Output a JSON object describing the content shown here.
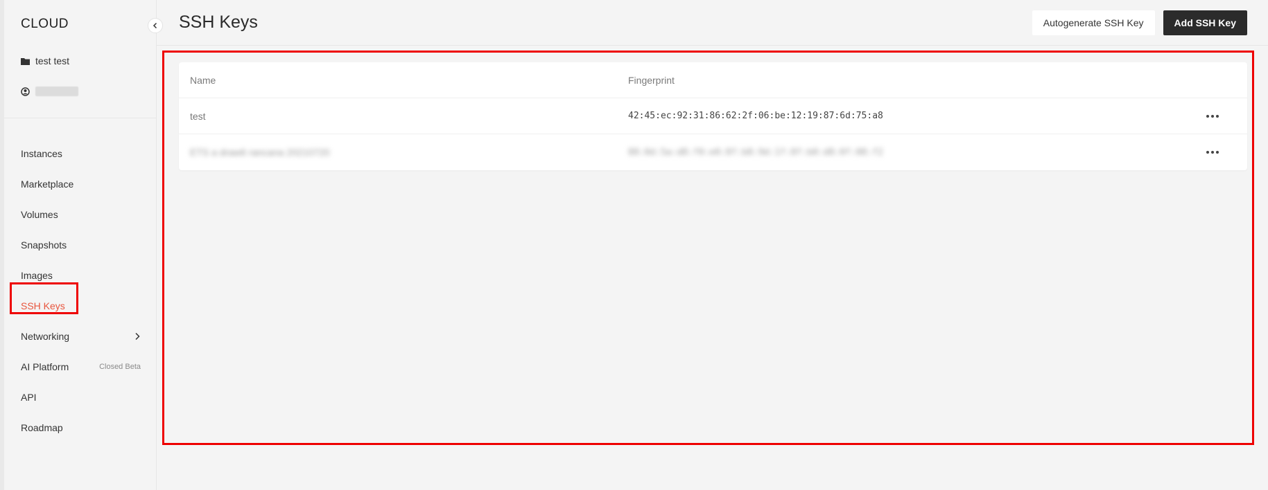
{
  "sidebar": {
    "brand": "CLOUD",
    "project": {
      "icon": "folder-icon",
      "label": "test test"
    },
    "account": {
      "icon": "user-circle-icon"
    },
    "nav": [
      {
        "label": "Instances"
      },
      {
        "label": "Marketplace"
      },
      {
        "label": "Volumes"
      },
      {
        "label": "Snapshots"
      },
      {
        "label": "Images"
      },
      {
        "label": "SSH Keys",
        "active": true
      },
      {
        "label": "Networking",
        "icon": "chevron-right-icon"
      },
      {
        "label": "AI Platform",
        "badge": "Closed Beta"
      },
      {
        "label": "API"
      },
      {
        "label": "Roadmap"
      }
    ]
  },
  "header": {
    "title": "SSH Keys",
    "autogenerate_label": "Autogenerate SSH Key",
    "add_label": "Add SSH Key"
  },
  "table": {
    "columns": {
      "name": "Name",
      "fingerprint": "Fingerprint"
    },
    "rows": [
      {
        "name": "test",
        "fingerprint": "42:45:ec:92:31:86:62:2f:06:be:12:19:87:6d:75:a8"
      },
      {
        "name": "ETS a draw6 rancana 20210720",
        "fingerprint": "88:0d:5a:d8:f0:e0:8f:b8:9d:1f:8f:b0:d8:0f:08:f2"
      }
    ]
  },
  "colors": {
    "accent": "#e8553d",
    "primary_button": "#2b2b2b",
    "highlight": "#ee0000"
  }
}
